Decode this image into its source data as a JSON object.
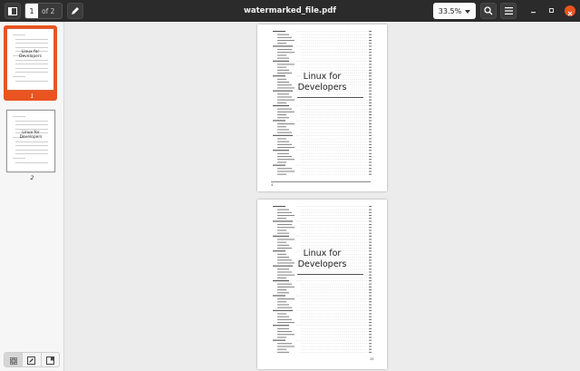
{
  "header": {
    "title": "watermarked_file.pdf",
    "page_current": "1",
    "page_of": "of 2",
    "zoom": "33.5%",
    "icons": [
      "sidebar-toggle-icon",
      "annotate-pen-icon",
      "search-icon",
      "hamburger-menu-icon",
      "minimize-icon",
      "maximize-icon",
      "close-icon"
    ]
  },
  "sidebar": {
    "thumbnails": [
      {
        "label": "1",
        "watermark_line1": "Linux for",
        "watermark_line2": "Developers",
        "selected": true
      },
      {
        "label": "2",
        "watermark_line1": "Linux for",
        "watermark_line2": "Developers",
        "selected": false
      }
    ],
    "bottom_buttons": [
      "thumbnails-icon",
      "annotations-icon",
      "bookmarks-icon"
    ]
  },
  "document": {
    "pages": [
      {
        "watermark_line1": "Linux for",
        "watermark_line2": "Developers",
        "footer_number": "4"
      },
      {
        "watermark_line1": "Linux for",
        "watermark_line2": "Developers",
        "footer_number": "15"
      }
    ]
  },
  "colors": {
    "accent": "#e95420",
    "header_bg": "#2b2b2b"
  }
}
